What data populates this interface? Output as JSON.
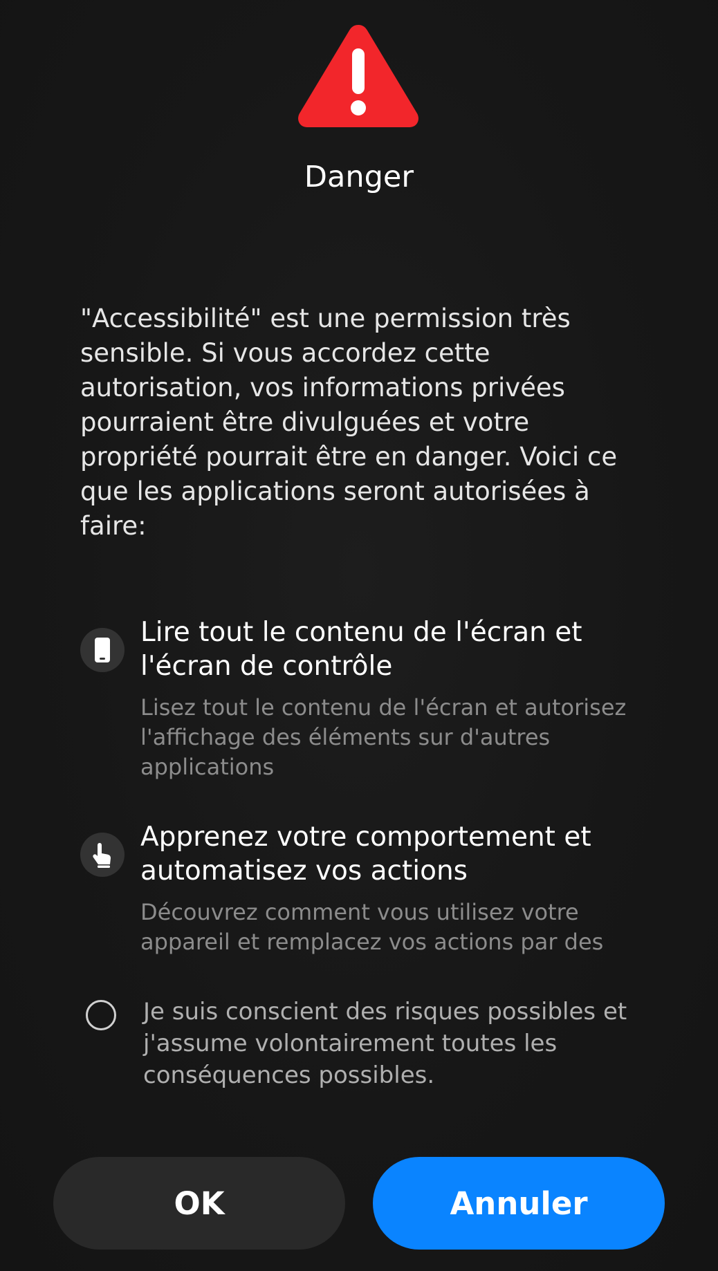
{
  "dialog": {
    "title": "Danger",
    "description": "\"Accessibilité\" est une permission très sensible. Si vous accordez cette autorisation, vos informations privées pourraient être divulguées et votre propriété pourrait être en danger. Voici ce que les applications seront autorisées à faire:",
    "permissions": [
      {
        "icon": "phone-icon",
        "title": "Lire tout le contenu de l'écran et l'écran de contrôle",
        "description": "Lisez tout le contenu de l'écran et autorisez l'affichage des éléments sur d'autres applications"
      },
      {
        "icon": "hand-pointer-icon",
        "title": "Apprenez votre comportement et automatisez vos actions",
        "description": "Découvrez comment vous utilisez votre appareil et remplacez vos actions par des"
      }
    ],
    "consent": {
      "label": "Je suis conscient des risques possibles et j'assume volontairement toutes les conséquences possibles.",
      "checked": false
    },
    "buttons": {
      "ok": "OK",
      "cancel": "Annuler"
    }
  },
  "colors": {
    "background": "#151515",
    "warning": "#f2262b",
    "accent": "#0a84ff",
    "secondary_button": "#292929"
  }
}
